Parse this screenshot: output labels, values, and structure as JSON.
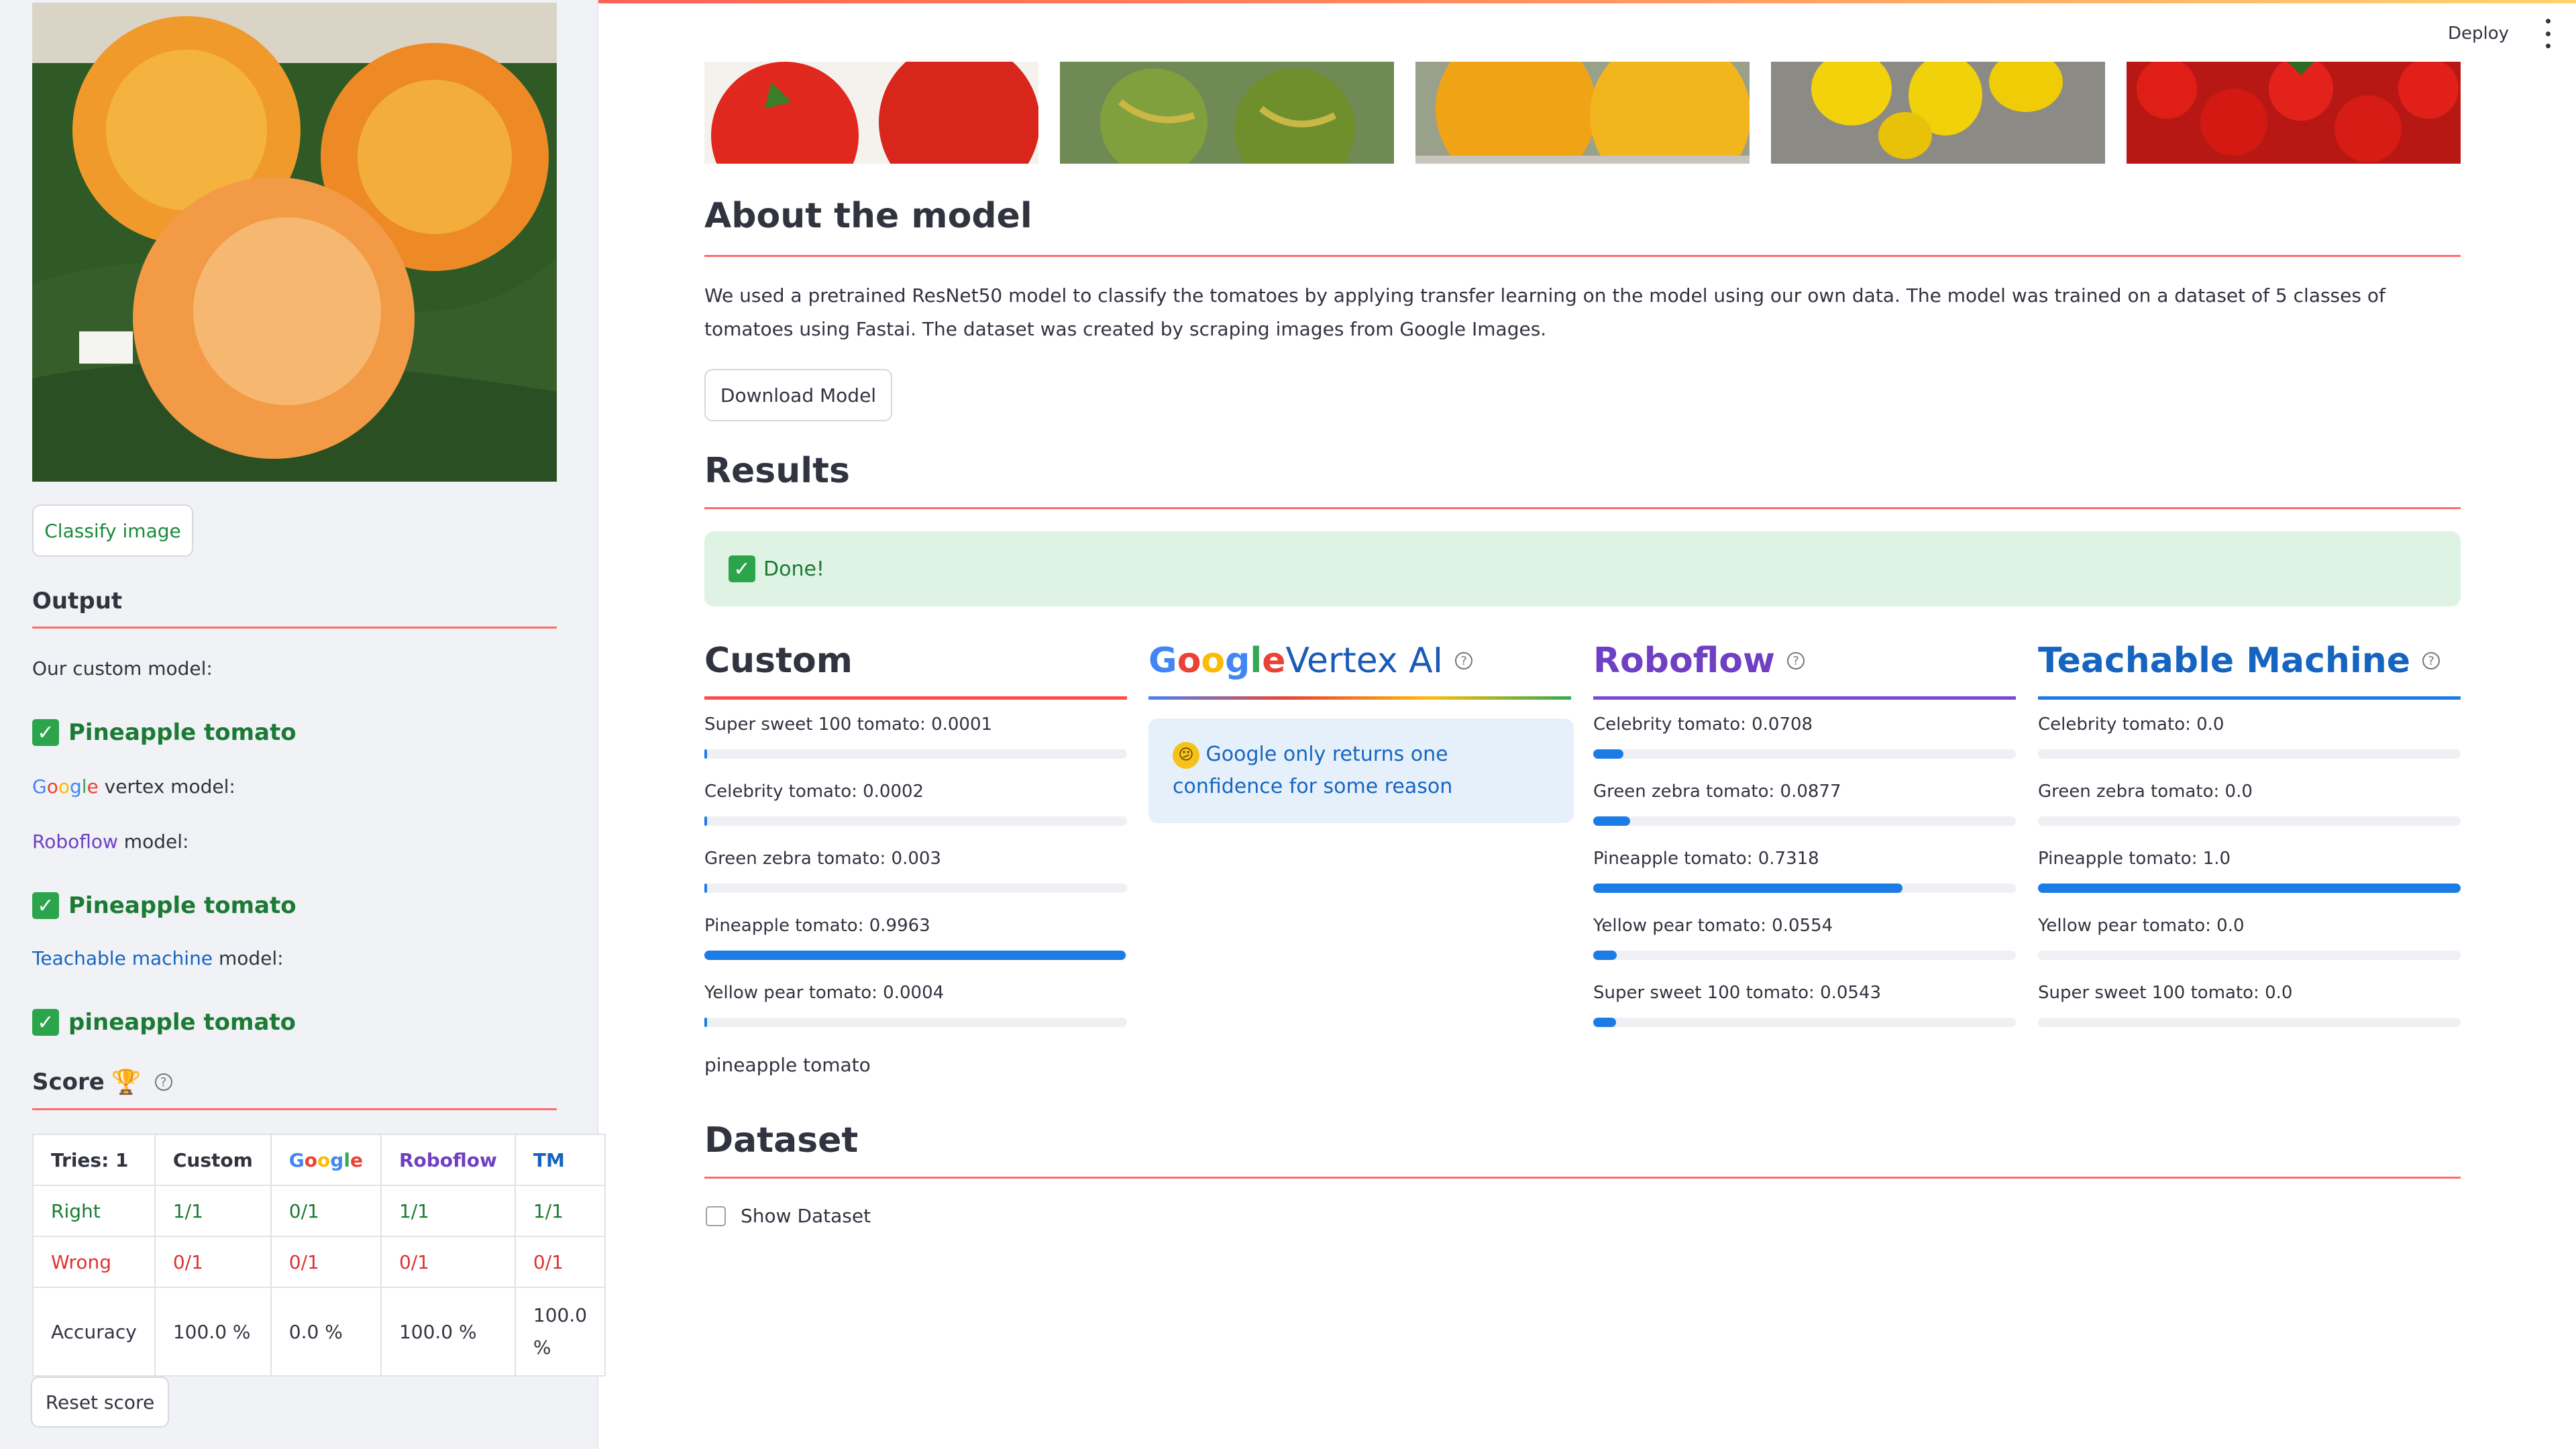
{
  "header": {
    "deploy_label": "Deploy"
  },
  "sidebar": {
    "classify_button": "Classify image",
    "output_title": "Output",
    "custom_label": "Our custom model:",
    "custom_result": "Pineapple tomato",
    "google_word": "Google",
    "google_suffix": " vertex model:",
    "roboflow_word": "Roboflow",
    "roboflow_suffix": " model:",
    "roboflow_result": "Pineapple tomato",
    "teachable_word": "Teachable machine",
    "teachable_suffix": " model:",
    "teachable_result": "pineapple tomato",
    "score_title": "Score",
    "score_table": {
      "headers": [
        "Tries: 1",
        "Custom",
        "Google",
        "Roboflow",
        "TM"
      ],
      "rows": [
        {
          "label": "Right",
          "values": [
            "1/1",
            "0/1",
            "1/1",
            "1/1"
          ]
        },
        {
          "label": "Wrong",
          "values": [
            "0/1",
            "0/1",
            "0/1",
            "0/1"
          ]
        },
        {
          "label": "Accuracy",
          "values": [
            "100.0 %",
            "0.0 %",
            "100.0 %",
            "100.0 %"
          ]
        }
      ]
    },
    "reset_button": "Reset score"
  },
  "main": {
    "about_title": "About the model",
    "about_text": "We used a pretrained ResNet50 model to classify the tomatoes by applying transfer learning on the model using our own data. The model was trained on a dataset of 5 classes of tomatoes using Fastai. The dataset was created by scraping images from Google Images.",
    "download_button": "Download Model",
    "results_title": "Results",
    "success_text": "Done!",
    "custom": {
      "title": "Custom",
      "bars": [
        {
          "label": "Super sweet 100 tomato: 0.0001",
          "value": 0.0001
        },
        {
          "label": "Celebrity tomato: 0.0002",
          "value": 0.0002
        },
        {
          "label": "Green zebra tomato: 0.003",
          "value": 0.003
        },
        {
          "label": "Pineapple tomato: 0.9963",
          "value": 0.9963
        },
        {
          "label": "Yellow pear tomato: 0.0004",
          "value": 0.0004
        }
      ],
      "prediction": "pineapple tomato"
    },
    "google": {
      "title_google": "Google",
      "title_rest": "Vertex AI",
      "info": "Google only returns one confidence for some reason"
    },
    "roboflow": {
      "title": "Roboflow",
      "bars": [
        {
          "label": "Celebrity tomato: 0.0708",
          "value": 0.0708
        },
        {
          "label": "Green zebra tomato: 0.0877",
          "value": 0.0877
        },
        {
          "label": "Pineapple tomato: 0.7318",
          "value": 0.7318
        },
        {
          "label": "Yellow pear tomato: 0.0554",
          "value": 0.0554
        },
        {
          "label": "Super sweet 100 tomato: 0.0543",
          "value": 0.0543
        }
      ]
    },
    "teachable": {
      "title": "Teachable Machine",
      "bars": [
        {
          "label": "Celebrity tomato: 0.0",
          "value": 0.0
        },
        {
          "label": "Green zebra tomato: 0.0",
          "value": 0.0
        },
        {
          "label": "Pineapple tomato: 1.0",
          "value": 1.0
        },
        {
          "label": "Yellow pear tomato: 0.0",
          "value": 0.0
        },
        {
          "label": "Super sweet 100 tomato: 0.0",
          "value": 0.0
        }
      ]
    },
    "dataset_title": "Dataset",
    "show_dataset_label": "Show Dataset"
  },
  "colors": {
    "accent_red": "#ff4b4b",
    "success_green": "#1b7a34",
    "roboflow_purple": "#6f3fc4",
    "teachable_blue": "#1565c0",
    "bar_blue": "#1c7ce5"
  },
  "icons": [
    "check-icon",
    "trophy-icon",
    "help-icon",
    "confused-face-icon",
    "kebab-menu-icon"
  ]
}
